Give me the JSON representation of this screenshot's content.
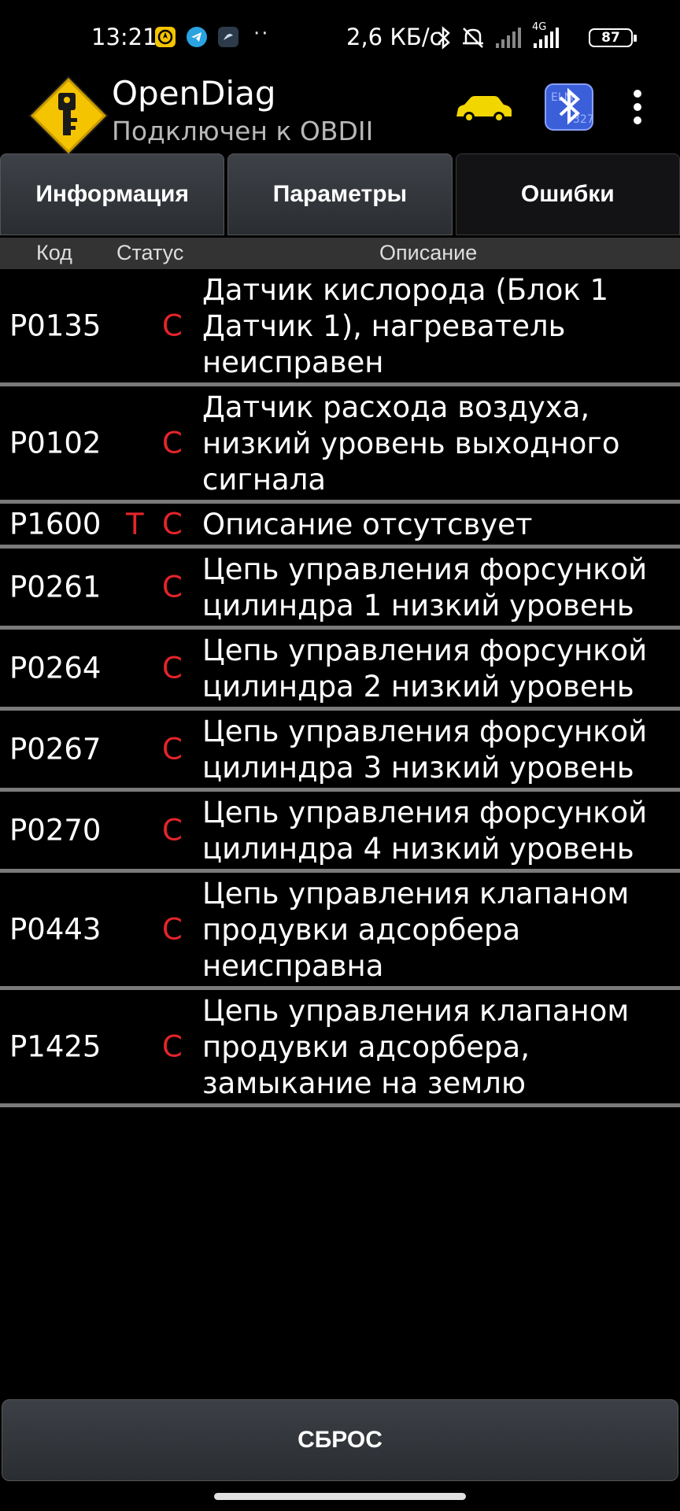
{
  "status_bar": {
    "time": "13:21",
    "dots": "··",
    "speed": "2,6 КБ/с",
    "network_type": "4G",
    "battery": "87"
  },
  "app_bar": {
    "title": "OpenDiag",
    "subtitle": "Подключен к OBDII"
  },
  "tabs": [
    {
      "label": "Информация",
      "active": false
    },
    {
      "label": "Параметры",
      "active": false
    },
    {
      "label": "Ошибки",
      "active": true
    }
  ],
  "table": {
    "headers": {
      "code": "Код",
      "status": "Статус",
      "description": "Описание"
    },
    "rows": [
      {
        "code": "P0135",
        "status_t": "",
        "status_c": "C",
        "description": "Датчик кислорода (Блок 1 Датчик 1), нагреватель неисправен"
      },
      {
        "code": "P0102",
        "status_t": "",
        "status_c": "C",
        "description": "Датчик расхода воздуха, низкий уровень выходного сигнала"
      },
      {
        "code": "P1600",
        "status_t": "T",
        "status_c": "C",
        "description": "Описание отсутсвует"
      },
      {
        "code": "P0261",
        "status_t": "",
        "status_c": "C",
        "description": "Цепь управления форсункой цилиндра 1 низкий уровень"
      },
      {
        "code": "P0264",
        "status_t": "",
        "status_c": "C",
        "description": "Цепь управления форсункой цилиндра 2 низкий уровень"
      },
      {
        "code": "P0267",
        "status_t": "",
        "status_c": "C",
        "description": "Цепь управления форсункой цилиндра 3 низкий уровень"
      },
      {
        "code": "P0270",
        "status_t": "",
        "status_c": "C",
        "description": "Цепь управления форсункой цилиндра 4 низкий уровень"
      },
      {
        "code": "P0443",
        "status_t": "",
        "status_c": "C",
        "description": "Цепь управления клапаном продувки адсорбера неисправна"
      },
      {
        "code": "P1425",
        "status_t": "",
        "status_c": "C",
        "description": "Цепь управления клапаном продувки адсорбера, замыкание на землю"
      }
    ]
  },
  "reset_button": {
    "label": "СБРОС"
  },
  "colors": {
    "status_red": "#e4252a",
    "logo_yellow": "#f5c400",
    "car_yellow": "#f2d600",
    "bt_blue": "#3b5fd8"
  },
  "icons": [
    "logo-diamond-key-icon",
    "car-icon",
    "bluetooth-adapter-icon",
    "more-vert-icon",
    "bluetooth-status-icon",
    "mute-bell-icon",
    "signal-icon",
    "battery-icon"
  ]
}
